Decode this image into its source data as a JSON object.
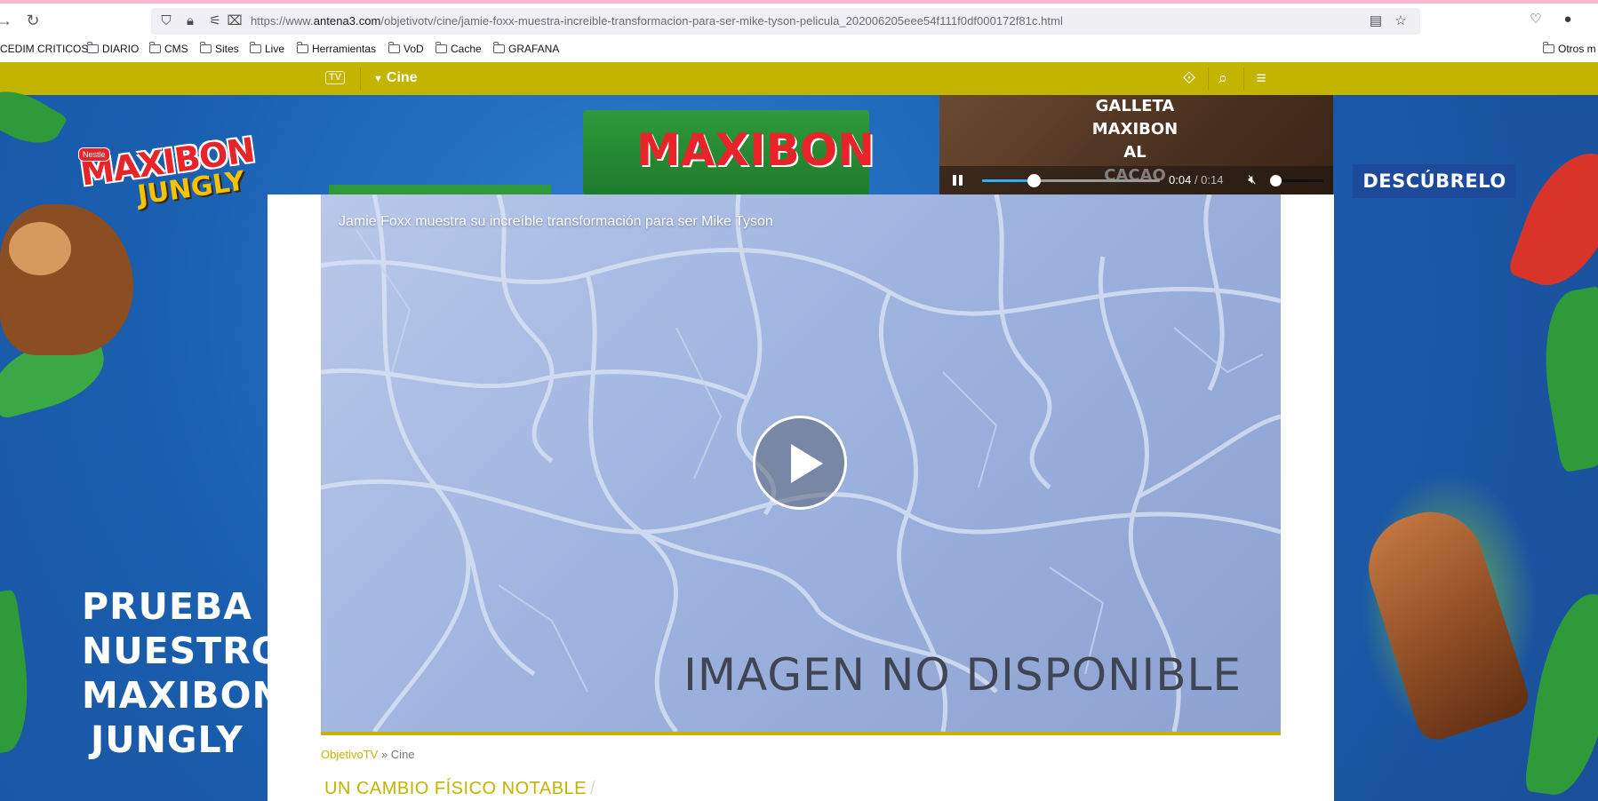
{
  "browser": {
    "url_prefix": "https://www.",
    "url_host": "antena3.com",
    "url_path": "/objetivotv/cine/jamie-foxx-muestra-increible-transformacion-para-ser-mike-tyson-pelicula_202006205eee54f111f0df000172f81c.html",
    "bookmarks": [
      "CEDIM CRITICOS",
      "DIARIO",
      "CMS",
      "Sites",
      "Live",
      "Herramientas",
      "VoD",
      "Cache",
      "GRAFANA"
    ],
    "bookmarks_other": "Otros m"
  },
  "site_nav": {
    "tv_logo": "TV",
    "section": "Cine"
  },
  "ad": {
    "brand": "MAXIBON",
    "sub_brand": "JUNGLY",
    "nestle": "Nestle",
    "slogan": [
      "PRUEBA",
      "NUESTRO",
      "MAXIBON",
      "JUNGLY"
    ],
    "cta": "DESCÚBRELO",
    "product_box_text": "MAXIBON",
    "mini_video": {
      "caption": "GALLETA MAXIBON AL CACAO",
      "current_time": "0:04",
      "total_time": "/ 0:14",
      "progress": 0.29
    }
  },
  "player": {
    "title": "Jamie Foxx muestra su increíble transformación para ser Mike Tyson",
    "unavailable_text": "IMAGEN NO DISPONIBLE"
  },
  "breadcrumb": {
    "home": "ObjetivoTV",
    "separator": "»",
    "current": "Cine"
  },
  "subheading": "UN CAMBIO FÍSICO NOTABLE"
}
